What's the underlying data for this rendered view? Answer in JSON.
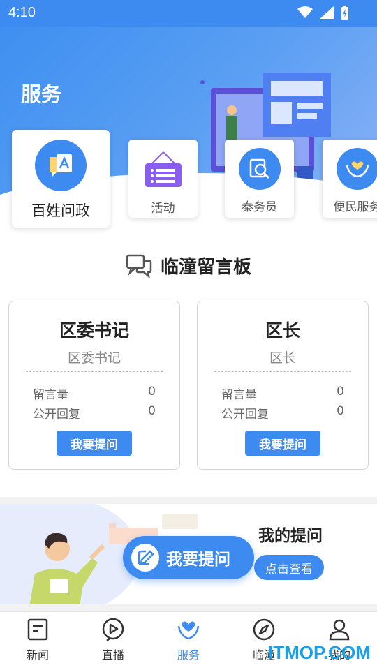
{
  "status_bar": {
    "time": "4:10",
    "icons": [
      "wifi-icon",
      "signal-icon",
      "battery-charging-icon"
    ]
  },
  "header": {
    "title": "服务"
  },
  "services": [
    {
      "label": "百姓问政",
      "icon": "question-board-icon"
    },
    {
      "label": "活动",
      "icon": "activity-sign-icon"
    },
    {
      "label": "秦务员",
      "icon": "search-document-icon"
    },
    {
      "label": "便民服务",
      "icon": "helping-hands-icon"
    }
  ],
  "board": {
    "title": "临潼留言板"
  },
  "leaders": [
    {
      "name": "区委书记",
      "subtitle": "区委书记",
      "stats": [
        {
          "label": "留言量",
          "value": "0"
        },
        {
          "label": "公开回复",
          "value": "0"
        }
      ],
      "button": "我要提问"
    },
    {
      "name": "区长",
      "subtitle": "区长",
      "stats": [
        {
          "label": "留言量",
          "value": "0"
        },
        {
          "label": "公开回复",
          "value": "0"
        }
      ],
      "button": "我要提问"
    }
  ],
  "my_question": {
    "title": "我的提问",
    "view_button": "点击查看",
    "float_button": "我要提问"
  },
  "bottom_nav": [
    {
      "label": "新闻",
      "icon": "news-icon",
      "active": false
    },
    {
      "label": "直播",
      "icon": "play-icon",
      "active": false
    },
    {
      "label": "服务",
      "icon": "heart-hands-icon",
      "active": true
    },
    {
      "label": "临潼",
      "icon": "compass-icon",
      "active": false
    },
    {
      "label": "我的",
      "icon": "user-icon",
      "active": false
    }
  ],
  "watermark": "ITMOP.COM",
  "colors": {
    "primary": "#3d8af0",
    "activity": "#8a5cf0"
  }
}
